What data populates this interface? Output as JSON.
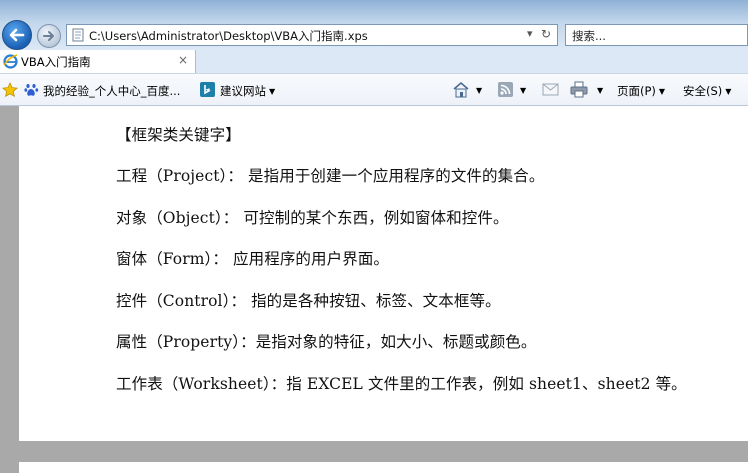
{
  "browser": {
    "address": "C:\\Users\\Administrator\\Desktop\\VBA入门指南.xps",
    "search_placeholder": "搜索...",
    "tab_title": "VBA入门指南",
    "tab_close": "×",
    "favorites": [
      {
        "label": "我的经验_个人中心_百度..."
      },
      {
        "label": "建议网站"
      }
    ],
    "commands": {
      "page": "页面(P)",
      "safety": "安全(S)"
    },
    "colors": {
      "accent": "#1a5fb4",
      "chrome": "#dce8f5",
      "doc_bg": "#a9a9a9"
    }
  },
  "document": {
    "heading": "【框架类关键字】",
    "lines": [
      "工程（Project）： 是指用于创建一个应用程序的文件的集合。",
      "对象（Object）： 可控制的某个东西，例如窗体和控件。",
      "窗体（Form）： 应用程序的用户界面。",
      "控件（Control）： 指的是各种按钮、标签、文本框等。",
      "属性（Property）：是指对象的特征，如大小、标题或颜色。",
      "工作表（Worksheet）：指 EXCEL 文件里的工作表，例如 sheet1、sheet2 等。"
    ]
  }
}
